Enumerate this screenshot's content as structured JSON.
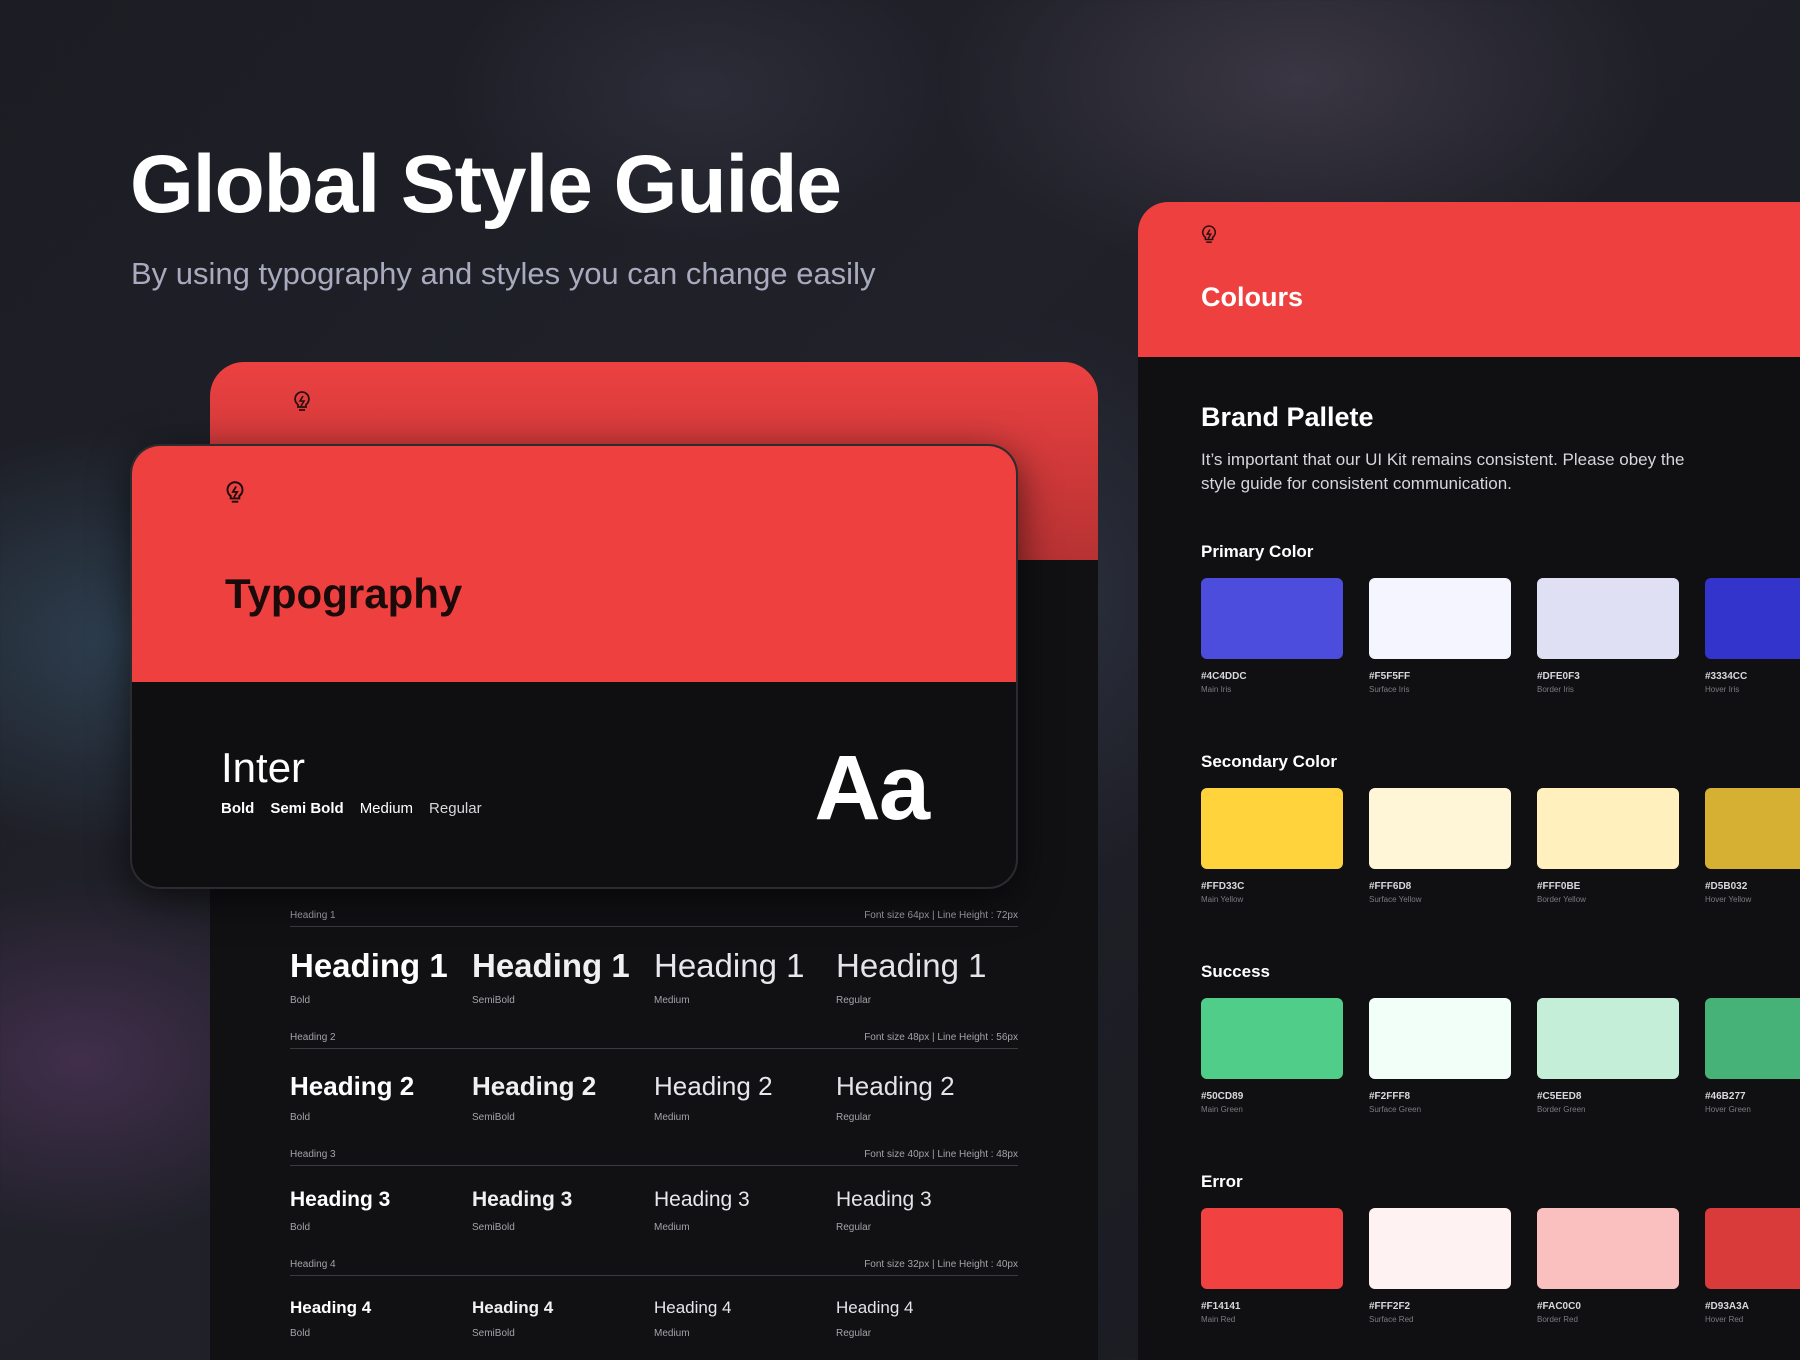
{
  "hero": {
    "title": "Global Style Guide",
    "subtitle": "By using typography and styles you can change easily"
  },
  "typography_card": {
    "title": "Typography",
    "font_name": "Inter",
    "weights": [
      "Bold",
      "Semi Bold",
      "Medium",
      "Regular"
    ],
    "sample_glyph": "Aa",
    "icon": "lightbulb-icon"
  },
  "typography_scale": [
    {
      "label": "Heading 1",
      "spec": "Font size 64px | Line Height : 72px",
      "samples": [
        {
          "text": "Heading 1",
          "weight": "Bold"
        },
        {
          "text": "Heading 1",
          "weight": "SemiBold"
        },
        {
          "text": "Heading 1",
          "weight": "Medium"
        },
        {
          "text": "Heading 1",
          "weight": "Regular"
        }
      ]
    },
    {
      "label": "Heading 2",
      "spec": "Font size 48px | Line Height : 56px",
      "samples": [
        {
          "text": "Heading 2",
          "weight": "Bold"
        },
        {
          "text": "Heading 2",
          "weight": "SemiBold"
        },
        {
          "text": "Heading 2",
          "weight": "Medium"
        },
        {
          "text": "Heading 2",
          "weight": "Regular"
        }
      ]
    },
    {
      "label": "Heading 3",
      "spec": "Font size 40px | Line Height : 48px",
      "samples": [
        {
          "text": "Heading 3",
          "weight": "Bold"
        },
        {
          "text": "Heading 3",
          "weight": "SemiBold"
        },
        {
          "text": "Heading 3",
          "weight": "Medium"
        },
        {
          "text": "Heading 3",
          "weight": "Regular"
        }
      ]
    },
    {
      "label": "Heading 4",
      "spec": "Font size 32px | Line Height : 40px",
      "samples": [
        {
          "text": "Heading 4",
          "weight": "Bold"
        },
        {
          "text": "Heading 4",
          "weight": "SemiBold"
        },
        {
          "text": "Heading 4",
          "weight": "Medium"
        },
        {
          "text": "Heading 4",
          "weight": "Regular"
        }
      ]
    }
  ],
  "colours": {
    "header_title": "Colours",
    "palette_title": "Brand Pallete",
    "palette_description": "It’s important that our UI Kit remains consistent. Please obey the style guide for consistent communication.",
    "groups": [
      {
        "title": "Primary Color",
        "swatches": [
          {
            "hex": "#4C4DDC",
            "name": "Main Iris",
            "color": "#4C4DDC"
          },
          {
            "hex": "#F5F5FF",
            "name": "Surface Iris",
            "color": "#F5F5FF"
          },
          {
            "hex": "#DFE0F3",
            "name": "Border Iris",
            "color": "#DFE0F3"
          },
          {
            "hex": "#3334CC",
            "name": "Hover Iris",
            "color": "#3334CC"
          }
        ]
      },
      {
        "title": "Secondary Color",
        "swatches": [
          {
            "hex": "#FFD33C",
            "name": "Main Yellow",
            "color": "#FFD33C"
          },
          {
            "hex": "#FFF6D8",
            "name": "Surface Yellow",
            "color": "#FFF6D8"
          },
          {
            "hex": "#FFF0BE",
            "name": "Border Yellow",
            "color": "#FFF0BE"
          },
          {
            "hex": "#D5B032",
            "name": "Hover Yellow",
            "color": "#D5B032"
          }
        ]
      },
      {
        "title": "Success",
        "swatches": [
          {
            "hex": "#50CD89",
            "name": "Main Green",
            "color": "#50CD89"
          },
          {
            "hex": "#F2FFF8",
            "name": "Surface Green",
            "color": "#F2FFF8"
          },
          {
            "hex": "#C5EED8",
            "name": "Border Green",
            "color": "#C5EED8"
          },
          {
            "hex": "#46B277",
            "name": "Hover Green",
            "color": "#46B277"
          }
        ]
      },
      {
        "title": "Error",
        "swatches": [
          {
            "hex": "#F14141",
            "name": "Main Red",
            "color": "#F14141"
          },
          {
            "hex": "#FFF2F2",
            "name": "Surface Red",
            "color": "#FFF2F2"
          },
          {
            "hex": "#FAC0C0",
            "name": "Border Red",
            "color": "#FAC0C0"
          },
          {
            "hex": "#D93A3A",
            "name": "Hover Red",
            "color": "#D93A3A"
          }
        ]
      }
    ]
  },
  "theme": {
    "accent": "#EF4040",
    "card_bg": "#101012"
  }
}
